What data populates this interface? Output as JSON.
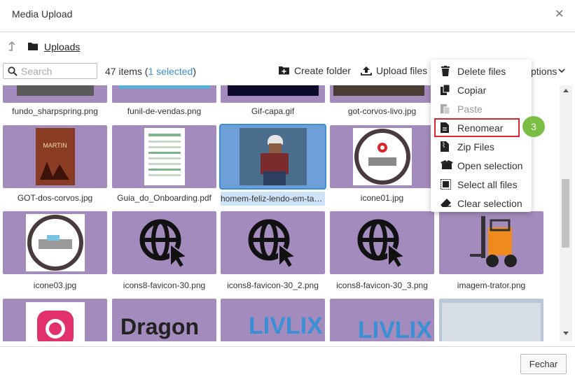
{
  "dialog": {
    "title": "Media Upload",
    "close_glyph": "✕"
  },
  "breadcrumb": {
    "label": "Uploads"
  },
  "toolbar": {
    "search_placeholder": "Search",
    "items_count": "47 items",
    "selected_text": "1 selected",
    "create_folder": "Create folder",
    "upload_files": "Upload files",
    "options_label": "ptions"
  },
  "files": [
    "fundo_sharpspring.png",
    "funil-de-vendas.png",
    "Gif-capa.gif",
    "got-corvos-livo.jpg",
    "GOT-dos-corvos.jpg",
    "Guia_do_Onboarding.pdf",
    "homem-feliz-lendo-em-tablet.jpg",
    "icone01.jpg",
    "icone03.jpg",
    "icons8-favicon-30.png",
    "icons8-favicon-30_2.png",
    "icons8-favicon-30_3.png",
    "imagem-trator.png"
  ],
  "menu": {
    "delete": "Delete files",
    "copy": "Copiar",
    "paste": "Paste",
    "rename": "Renomear",
    "zip": "Zip Files",
    "open_selection": "Open selection",
    "select_all": "Select all files",
    "clear_selection": "Clear selection"
  },
  "step_badge": "3",
  "tile_thumbs": {
    "dragon_text": "Dragon",
    "livlix_text": "LIVLIX",
    "book_text": "MARTIN"
  },
  "footer": {
    "close_button": "Fechar"
  },
  "colors": {
    "tile": "#a48bbd",
    "selected_tile": "#6f9fd8",
    "accent": "#3a8fd5",
    "highlight_border": "#d9262c",
    "badge": "#7cbd43"
  }
}
